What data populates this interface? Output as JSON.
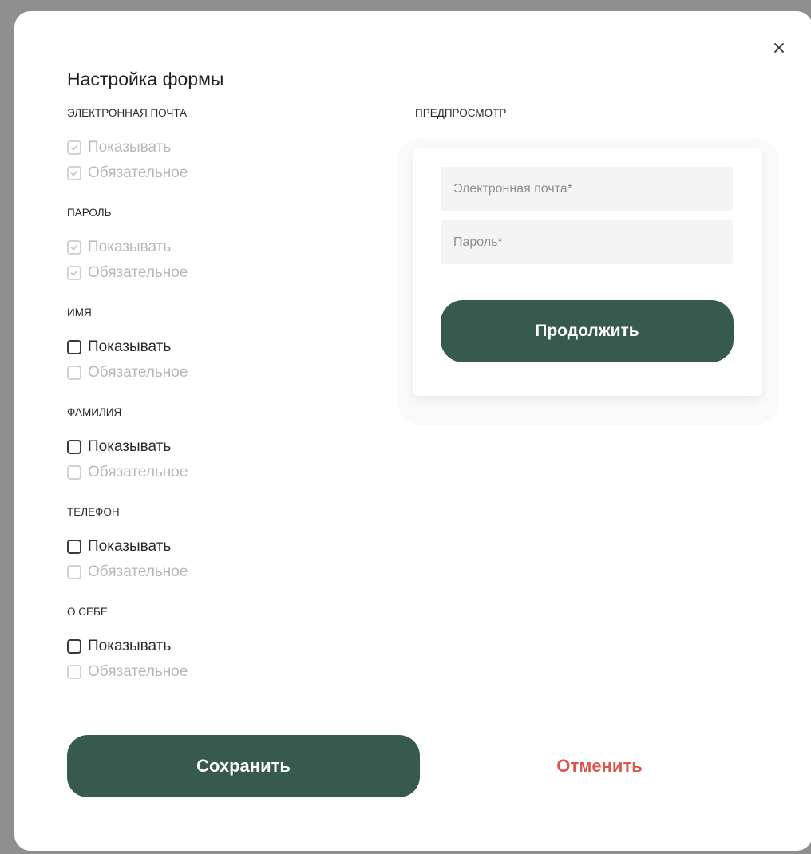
{
  "modal": {
    "title": "Настройка формы",
    "close_icon": "close-icon"
  },
  "sections": [
    {
      "label": "ЭЛЕКТРОННАЯ ПОЧТА",
      "show": {
        "label": "Показывать",
        "checked": true,
        "disabled": true
      },
      "required": {
        "label": "Обязательное",
        "checked": true,
        "disabled": true
      }
    },
    {
      "label": "ПАРОЛЬ",
      "show": {
        "label": "Показывать",
        "checked": true,
        "disabled": true
      },
      "required": {
        "label": "Обязательное",
        "checked": true,
        "disabled": true
      }
    },
    {
      "label": "ИМЯ",
      "show": {
        "label": "Показывать",
        "checked": false,
        "disabled": false
      },
      "required": {
        "label": "Обязательное",
        "checked": false,
        "disabled": true
      }
    },
    {
      "label": "ФАМИЛИЯ",
      "show": {
        "label": "Показывать",
        "checked": false,
        "disabled": false
      },
      "required": {
        "label": "Обязательное",
        "checked": false,
        "disabled": true
      }
    },
    {
      "label": "ТЕЛЕФОН",
      "show": {
        "label": "Показывать",
        "checked": false,
        "disabled": false
      },
      "required": {
        "label": "Обязательное",
        "checked": false,
        "disabled": true
      }
    },
    {
      "label": "О СЕБЕ",
      "show": {
        "label": "Показывать",
        "checked": false,
        "disabled": false
      },
      "required": {
        "label": "Обязательное",
        "checked": false,
        "disabled": true
      }
    }
  ],
  "preview": {
    "label": "ПРЕДПРОСМОТР",
    "email_placeholder": "Электронная почта*",
    "password_placeholder": "Пароль*",
    "continue_label": "Продолжить"
  },
  "actions": {
    "save_label": "Сохранить",
    "cancel_label": "Отменить"
  },
  "colors": {
    "primary": "#365a4d",
    "danger": "#d9574c",
    "disabled": "#b8b8b8"
  }
}
